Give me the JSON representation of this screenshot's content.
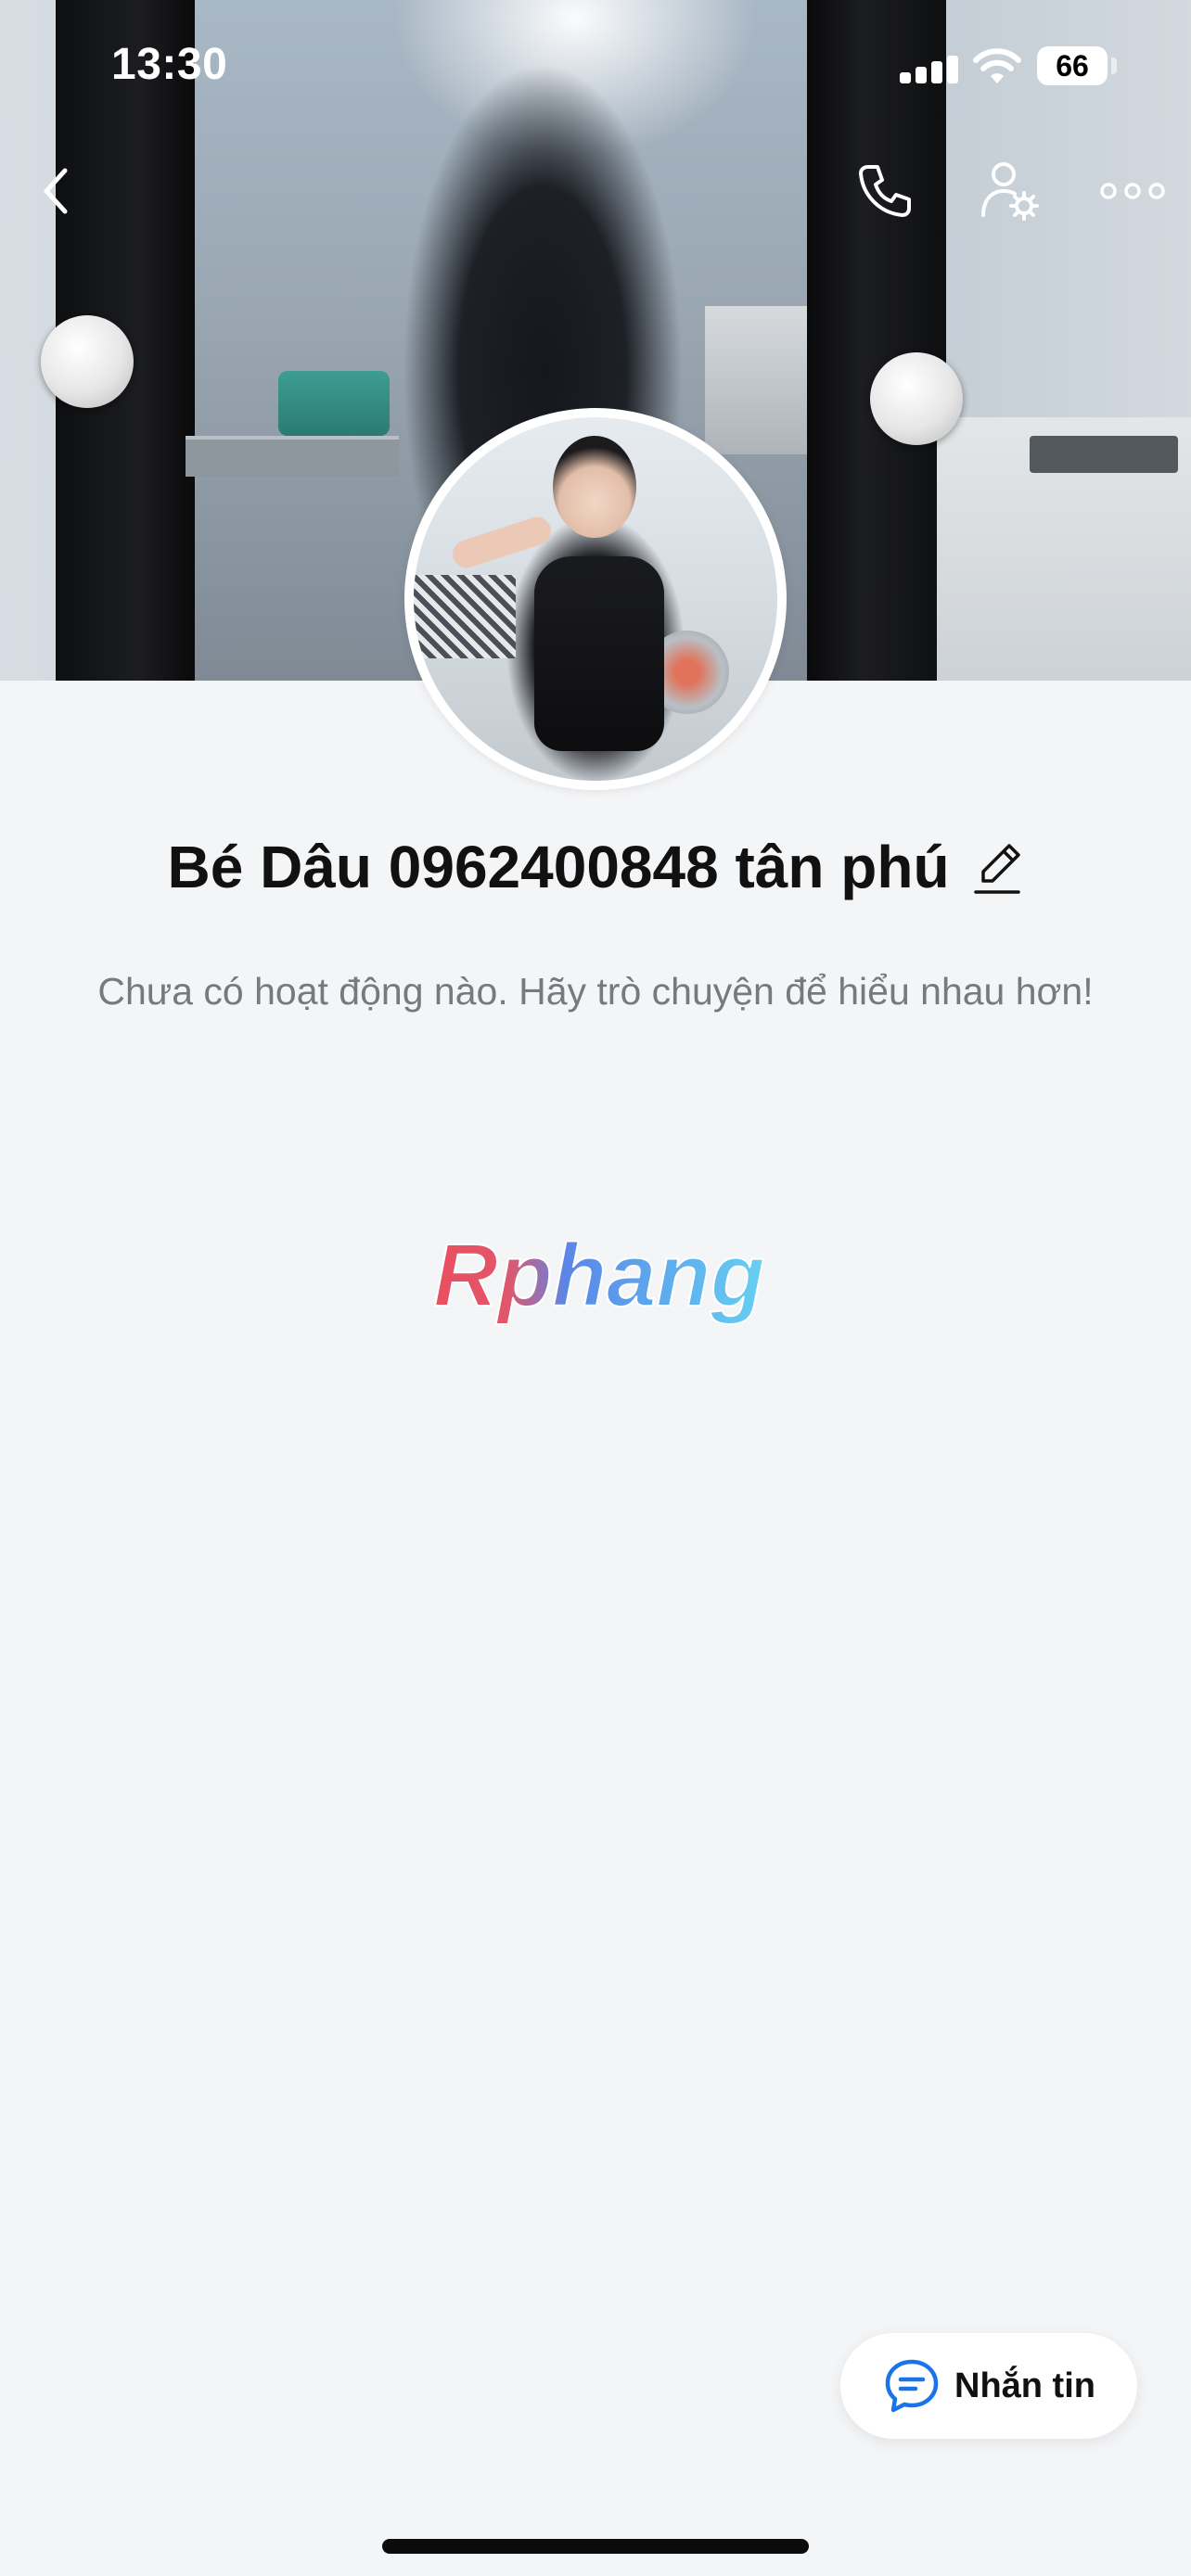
{
  "status_bar": {
    "time": "13:30",
    "battery": "66",
    "icons": [
      "signal-icon",
      "wifi-icon",
      "battery-icon"
    ]
  },
  "nav": {
    "icons": [
      "chevron-left-icon",
      "phone-icon",
      "user-settings-icon",
      "more-icon"
    ]
  },
  "profile": {
    "name": "Bé Dâu 0962400848 tân phú",
    "activity_text": "Chưa có hoạt động nào. Hãy trò chuyện để hiểu nhau hơn!"
  },
  "watermark": {
    "text": "Rphang"
  },
  "message_button": {
    "label": "Nhắn tin",
    "icon": "chat-bubble-icon"
  },
  "colors": {
    "background": "#f4f5f7",
    "accent_blue": "#1a73e8",
    "text_primary": "#111111",
    "text_secondary": "#767a80"
  }
}
